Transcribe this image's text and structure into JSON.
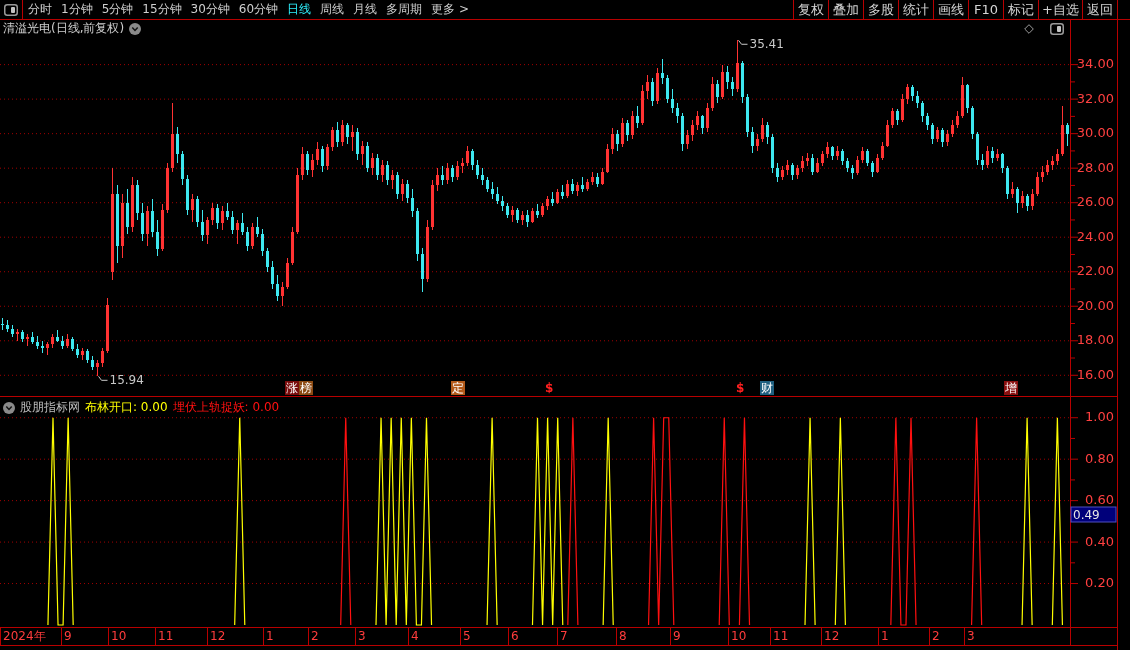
{
  "toolbar": {
    "period_tabs": [
      {
        "label": "分时",
        "selected": false
      },
      {
        "label": "1分钟",
        "selected": false
      },
      {
        "label": "5分钟",
        "selected": false
      },
      {
        "label": "15分钟",
        "selected": false
      },
      {
        "label": "30分钟",
        "selected": false
      },
      {
        "label": "60分钟",
        "selected": false
      },
      {
        "label": "日线",
        "selected": true
      },
      {
        "label": "周线",
        "selected": false
      },
      {
        "label": "月线",
        "selected": false
      },
      {
        "label": "多周期",
        "selected": false
      },
      {
        "label": "更多 >",
        "selected": false
      }
    ],
    "buttons": [
      "复权",
      "叠加",
      "多股",
      "统计",
      "画线",
      "F10",
      "标记",
      "+自选",
      "返回"
    ]
  },
  "price_pane": {
    "title": "清溢光电(日线,前复权)",
    "chart_data": [
      {
        "type": "candlestick",
        "ylim": [
          14.8,
          35.6
        ],
        "yticks": [
          {
            "value": 16,
            "label": "16.00"
          },
          {
            "value": 18,
            "label": "18.00"
          },
          {
            "value": 20,
            "label": "20.00"
          },
          {
            "value": 22,
            "label": "22.00"
          },
          {
            "value": 24,
            "label": "24.00"
          },
          {
            "value": 26,
            "label": "26.00"
          },
          {
            "value": 28,
            "label": "28.00"
          },
          {
            "value": 30,
            "label": "30.00"
          },
          {
            "value": 32,
            "label": "32.00"
          },
          {
            "value": 34,
            "label": "34.00"
          }
        ],
        "grid": true,
        "annotations": [
          "35.41",
          "15.94"
        ],
        "ohlc": [
          [
            19.0,
            19.3,
            18.6,
            18.9
          ],
          [
            18.9,
            19.2,
            18.5,
            18.7
          ],
          [
            18.7,
            18.9,
            18.2,
            18.4
          ],
          [
            18.4,
            18.7,
            18.0,
            18.5
          ],
          [
            18.5,
            18.6,
            17.9,
            18.1
          ],
          [
            18.1,
            18.4,
            17.7,
            18.2
          ],
          [
            18.2,
            18.5,
            17.8,
            17.9
          ],
          [
            17.9,
            18.3,
            17.5,
            17.7
          ],
          [
            17.7,
            18.0,
            17.3,
            17.6
          ],
          [
            17.6,
            17.9,
            17.2,
            17.8
          ],
          [
            17.8,
            18.4,
            17.6,
            18.2
          ],
          [
            18.2,
            18.6,
            17.9,
            18.0
          ],
          [
            18.0,
            18.3,
            17.5,
            17.7
          ],
          [
            17.7,
            18.4,
            17.6,
            18.1
          ],
          [
            18.1,
            18.2,
            17.4,
            17.5
          ],
          [
            17.5,
            17.8,
            17.0,
            17.2
          ],
          [
            17.2,
            17.6,
            16.9,
            17.4
          ],
          [
            17.4,
            17.5,
            16.7,
            16.9
          ],
          [
            16.9,
            17.1,
            16.3,
            16.5
          ],
          [
            16.5,
            16.9,
            15.94,
            16.7
          ],
          [
            16.7,
            17.6,
            16.5,
            17.4
          ],
          [
            17.4,
            20.5,
            17.3,
            20.1
          ],
          [
            22.0,
            28.0,
            21.5,
            26.5
          ],
          [
            26.5,
            27.0,
            22.5,
            23.5
          ],
          [
            23.5,
            26.5,
            22.8,
            26.0
          ],
          [
            26.0,
            26.8,
            24.2,
            24.6
          ],
          [
            24.6,
            27.5,
            24.3,
            27.0
          ],
          [
            27.0,
            27.3,
            25.0,
            25.4
          ],
          [
            25.4,
            26.0,
            23.8,
            24.2
          ],
          [
            24.2,
            25.8,
            23.5,
            25.5
          ],
          [
            25.5,
            26.2,
            24.0,
            24.3
          ],
          [
            24.3,
            25.0,
            22.9,
            23.3
          ],
          [
            23.3,
            25.9,
            23.2,
            25.6
          ],
          [
            25.6,
            28.3,
            25.4,
            28.0
          ],
          [
            28.0,
            31.8,
            27.8,
            30.0
          ],
          [
            30.0,
            30.4,
            28.3,
            28.8
          ],
          [
            28.8,
            29.0,
            27.0,
            27.4
          ],
          [
            27.4,
            27.6,
            25.3,
            25.6
          ],
          [
            25.6,
            26.5,
            24.9,
            26.2
          ],
          [
            26.2,
            26.4,
            24.6,
            24.9
          ],
          [
            24.9,
            25.6,
            23.8,
            24.1
          ],
          [
            24.1,
            25.2,
            23.6,
            25.0
          ],
          [
            25.0,
            26.0,
            24.7,
            25.7
          ],
          [
            25.7,
            25.9,
            24.5,
            24.8
          ],
          [
            24.8,
            25.8,
            24.4,
            25.5
          ],
          [
            25.5,
            26.0,
            25.0,
            25.2
          ],
          [
            25.2,
            25.5,
            24.2,
            24.4
          ],
          [
            24.4,
            25.0,
            23.6,
            24.8
          ],
          [
            24.8,
            25.4,
            24.1,
            24.3
          ],
          [
            24.3,
            24.6,
            23.2,
            23.5
          ],
          [
            23.5,
            24.8,
            23.3,
            24.6
          ],
          [
            24.6,
            25.2,
            24.0,
            24.2
          ],
          [
            24.2,
            24.5,
            22.9,
            23.2
          ],
          [
            23.2,
            23.4,
            22.0,
            22.3
          ],
          [
            22.3,
            22.6,
            21.0,
            21.3
          ],
          [
            21.3,
            21.8,
            20.3,
            20.6
          ],
          [
            20.6,
            21.4,
            20.0,
            21.1
          ],
          [
            21.1,
            22.8,
            21.0,
            22.5
          ],
          [
            22.5,
            24.6,
            22.4,
            24.3
          ],
          [
            24.3,
            28.0,
            24.2,
            27.6
          ],
          [
            27.6,
            29.2,
            27.3,
            28.8
          ],
          [
            28.8,
            29.0,
            27.6,
            27.9
          ],
          [
            27.9,
            28.8,
            27.5,
            28.5
          ],
          [
            28.5,
            29.5,
            28.2,
            29.1
          ],
          [
            29.1,
            29.3,
            27.8,
            28.1
          ],
          [
            28.1,
            29.4,
            27.9,
            29.2
          ],
          [
            29.2,
            30.4,
            29.0,
            30.2
          ],
          [
            30.2,
            30.7,
            29.2,
            29.5
          ],
          [
            29.5,
            30.8,
            29.3,
            30.5
          ],
          [
            30.5,
            30.6,
            29.4,
            29.8
          ],
          [
            29.8,
            30.5,
            29.0,
            30.1
          ],
          [
            30.1,
            30.3,
            28.5,
            28.8
          ],
          [
            28.8,
            29.6,
            28.2,
            29.3
          ],
          [
            29.3,
            29.5,
            27.8,
            28.0
          ],
          [
            28.0,
            28.9,
            27.6,
            28.6
          ],
          [
            28.6,
            28.8,
            27.3,
            27.6
          ],
          [
            27.6,
            28.5,
            27.2,
            28.2
          ],
          [
            28.2,
            28.4,
            27.0,
            27.3
          ],
          [
            27.3,
            27.9,
            26.8,
            27.6
          ],
          [
            27.6,
            27.8,
            26.2,
            26.5
          ],
          [
            26.5,
            27.4,
            26.1,
            27.1
          ],
          [
            27.1,
            27.3,
            26.0,
            26.3
          ],
          [
            26.3,
            26.8,
            25.2,
            25.5
          ],
          [
            25.5,
            25.7,
            22.6,
            23.0
          ],
          [
            23.0,
            23.4,
            20.8,
            21.6
          ],
          [
            21.6,
            25.0,
            21.4,
            24.6
          ],
          [
            24.6,
            27.3,
            24.4,
            27.0
          ],
          [
            27.0,
            28.0,
            26.7,
            27.6
          ],
          [
            27.6,
            28.1,
            27.0,
            27.3
          ],
          [
            27.3,
            28.3,
            27.1,
            28.0
          ],
          [
            28.0,
            28.2,
            27.2,
            27.5
          ],
          [
            27.5,
            28.4,
            27.3,
            28.1
          ],
          [
            28.1,
            28.6,
            27.7,
            28.3
          ],
          [
            28.3,
            29.3,
            28.1,
            29.0
          ],
          [
            29.0,
            29.1,
            27.9,
            28.2
          ],
          [
            28.2,
            28.5,
            27.4,
            27.6
          ],
          [
            27.6,
            28.0,
            27.0,
            27.3
          ],
          [
            27.3,
            27.5,
            26.6,
            26.8
          ],
          [
            26.8,
            27.2,
            26.2,
            26.5
          ],
          [
            26.5,
            26.9,
            25.9,
            26.1
          ],
          [
            26.1,
            26.4,
            25.5,
            25.8
          ],
          [
            25.8,
            26.0,
            25.1,
            25.3
          ],
          [
            25.3,
            25.8,
            24.9,
            25.6
          ],
          [
            25.6,
            25.7,
            24.8,
            25.0
          ],
          [
            25.0,
            25.5,
            24.7,
            25.3
          ],
          [
            25.3,
            25.6,
            24.6,
            24.9
          ],
          [
            24.9,
            25.7,
            24.8,
            25.5
          ],
          [
            25.5,
            25.9,
            25.1,
            25.3
          ],
          [
            25.3,
            26.0,
            25.2,
            25.8
          ],
          [
            25.8,
            26.4,
            25.6,
            26.2
          ],
          [
            26.2,
            26.6,
            25.8,
            26.0
          ],
          [
            26.0,
            26.8,
            25.9,
            26.6
          ],
          [
            26.6,
            27.0,
            26.2,
            26.4
          ],
          [
            26.4,
            27.3,
            26.3,
            27.1
          ],
          [
            27.1,
            27.4,
            26.5,
            26.7
          ],
          [
            26.7,
            27.2,
            26.4,
            27.0
          ],
          [
            27.0,
            27.5,
            26.6,
            26.8
          ],
          [
            26.8,
            27.4,
            26.7,
            27.2
          ],
          [
            27.2,
            27.8,
            27.0,
            27.5
          ],
          [
            27.5,
            27.7,
            26.9,
            27.1
          ],
          [
            27.1,
            28.0,
            27.0,
            27.8
          ],
          [
            27.8,
            29.4,
            27.7,
            29.1
          ],
          [
            29.1,
            30.3,
            28.8,
            30.0
          ],
          [
            30.0,
            30.2,
            29.0,
            29.4
          ],
          [
            29.4,
            30.9,
            29.2,
            30.6
          ],
          [
            30.6,
            30.8,
            29.6,
            29.9
          ],
          [
            29.9,
            31.3,
            29.7,
            31.0
          ],
          [
            31.0,
            31.6,
            30.3,
            30.6
          ],
          [
            30.6,
            32.8,
            30.5,
            32.5
          ],
          [
            32.5,
            33.4,
            32.0,
            33.0
          ],
          [
            33.0,
            33.2,
            31.6,
            31.9
          ],
          [
            31.9,
            33.8,
            31.7,
            33.5
          ],
          [
            33.5,
            34.3,
            32.9,
            33.2
          ],
          [
            33.2,
            33.4,
            31.8,
            32.0
          ],
          [
            32.0,
            32.6,
            31.2,
            31.5
          ],
          [
            31.5,
            31.8,
            30.6,
            31.0
          ],
          [
            31.0,
            31.2,
            29.0,
            29.4
          ],
          [
            29.4,
            30.2,
            29.1,
            29.9
          ],
          [
            29.9,
            30.8,
            29.6,
            30.5
          ],
          [
            30.5,
            31.3,
            30.2,
            31.0
          ],
          [
            31.0,
            31.1,
            30.0,
            30.3
          ],
          [
            30.3,
            31.8,
            30.1,
            31.5
          ],
          [
            31.5,
            33.3,
            31.3,
            32.9
          ],
          [
            32.9,
            33.1,
            31.8,
            32.1
          ],
          [
            32.1,
            34.0,
            32.0,
            33.6
          ],
          [
            33.6,
            33.9,
            32.6,
            33.0
          ],
          [
            33.0,
            33.3,
            32.2,
            32.6
          ],
          [
            32.6,
            35.41,
            32.4,
            34.1
          ],
          [
            34.1,
            34.2,
            31.8,
            32.1
          ],
          [
            32.1,
            32.3,
            29.8,
            30.1
          ],
          [
            30.1,
            30.4,
            28.9,
            29.3
          ],
          [
            29.3,
            30.0,
            29.0,
            29.7
          ],
          [
            29.7,
            30.9,
            29.5,
            30.5
          ],
          [
            30.5,
            30.7,
            29.4,
            29.8
          ],
          [
            29.8,
            30.0,
            27.7,
            28.0
          ],
          [
            28.0,
            28.3,
            27.2,
            27.5
          ],
          [
            27.5,
            28.1,
            27.3,
            27.9
          ],
          [
            27.9,
            28.5,
            27.6,
            28.2
          ],
          [
            28.2,
            28.3,
            27.3,
            27.6
          ],
          [
            27.6,
            28.2,
            27.4,
            28.0
          ],
          [
            28.0,
            28.7,
            27.8,
            28.4
          ],
          [
            28.4,
            28.9,
            28.1,
            28.6
          ],
          [
            28.6,
            28.8,
            27.6,
            27.8
          ],
          [
            27.8,
            28.6,
            27.7,
            28.3
          ],
          [
            28.3,
            29.0,
            28.1,
            28.8
          ],
          [
            28.8,
            29.5,
            28.6,
            29.2
          ],
          [
            29.2,
            29.3,
            28.5,
            28.7
          ],
          [
            28.7,
            29.3,
            28.5,
            29.0
          ],
          [
            29.0,
            29.1,
            28.2,
            28.4
          ],
          [
            28.4,
            28.6,
            27.8,
            28.0
          ],
          [
            28.0,
            28.2,
            27.4,
            27.7
          ],
          [
            27.7,
            28.7,
            27.6,
            28.5
          ],
          [
            28.5,
            29.2,
            28.3,
            29.0
          ],
          [
            29.0,
            29.1,
            28.1,
            28.3
          ],
          [
            28.3,
            28.4,
            27.5,
            27.8
          ],
          [
            27.8,
            28.8,
            27.7,
            28.6
          ],
          [
            28.6,
            29.5,
            28.5,
            29.3
          ],
          [
            29.3,
            30.8,
            29.2,
            30.5
          ],
          [
            30.5,
            31.5,
            30.3,
            31.3
          ],
          [
            31.3,
            31.4,
            30.5,
            30.8
          ],
          [
            30.8,
            32.3,
            30.7,
            32.0
          ],
          [
            32.0,
            32.9,
            31.7,
            32.7
          ],
          [
            32.7,
            32.8,
            31.9,
            32.2
          ],
          [
            32.2,
            32.5,
            31.5,
            31.8
          ],
          [
            31.8,
            31.9,
            30.7,
            31.0
          ],
          [
            31.0,
            31.2,
            30.2,
            30.5
          ],
          [
            30.5,
            30.6,
            29.4,
            29.7
          ],
          [
            29.7,
            30.4,
            29.5,
            30.2
          ],
          [
            30.2,
            30.3,
            29.2,
            29.5
          ],
          [
            29.5,
            30.2,
            29.3,
            30.0
          ],
          [
            30.0,
            30.8,
            29.8,
            30.5
          ],
          [
            30.5,
            31.3,
            30.3,
            31.0
          ],
          [
            31.0,
            33.3,
            30.9,
            32.8
          ],
          [
            32.8,
            32.9,
            31.2,
            31.5
          ],
          [
            31.5,
            31.6,
            29.7,
            30.0
          ],
          [
            30.0,
            30.1,
            28.2,
            28.5
          ],
          [
            28.5,
            28.8,
            27.9,
            28.2
          ],
          [
            28.2,
            29.3,
            28.0,
            29.0
          ],
          [
            29.0,
            29.2,
            28.3,
            28.6
          ],
          [
            28.6,
            29.1,
            28.4,
            28.8
          ],
          [
            28.8,
            28.9,
            27.7,
            28.0
          ],
          [
            28.0,
            28.1,
            26.2,
            26.5
          ],
          [
            26.5,
            27.2,
            26.3,
            26.8
          ],
          [
            26.8,
            26.9,
            25.4,
            26.0
          ],
          [
            26.0,
            26.7,
            25.7,
            26.4
          ],
          [
            26.4,
            26.5,
            25.5,
            25.8
          ],
          [
            25.8,
            26.8,
            25.6,
            26.5
          ],
          [
            26.5,
            27.8,
            26.4,
            27.5
          ],
          [
            27.5,
            28.1,
            27.2,
            27.8
          ],
          [
            27.8,
            28.5,
            27.6,
            28.2
          ],
          [
            28.2,
            28.7,
            27.9,
            28.4
          ],
          [
            28.4,
            29.1,
            28.2,
            28.8
          ],
          [
            28.8,
            31.6,
            28.7,
            30.5
          ],
          [
            30.5,
            30.6,
            29.3,
            30.0
          ]
        ]
      }
    ],
    "event_markers": [
      {
        "text": "涨",
        "kind": "badge",
        "color": "#7a0c0c"
      },
      {
        "text": "榜",
        "kind": "badge",
        "color": "#8c4a12"
      },
      {
        "text": "定",
        "kind": "badge",
        "color": "#b35a1a"
      },
      {
        "text": "$",
        "kind": "glyph",
        "color": "#ff2020"
      },
      {
        "text": "$",
        "kind": "glyph",
        "color": "#ff2020"
      },
      {
        "text": "财",
        "kind": "badge",
        "color": "#1f5f7f"
      },
      {
        "text": "增",
        "kind": "badge",
        "color": "#8a1010"
      }
    ]
  },
  "indicator_pane": {
    "source": "股朋指标网",
    "legend": [
      {
        "label": "布林开口: 0.00",
        "color": "#ffff00"
      },
      {
        "label": "埋伏上轨捉妖: 0.00",
        "color": "#ff1010"
      }
    ],
    "cursor_value": "0.49",
    "chart_data": [
      {
        "type": "line",
        "ylim": [
          0,
          1.1
        ],
        "yticks": [
          {
            "value": 0.2,
            "label": "0.20"
          },
          {
            "value": 0.4,
            "label": "0.40"
          },
          {
            "value": 0.6,
            "label": "0.60"
          },
          {
            "value": 0.8,
            "label": "0.80"
          },
          {
            "value": 1.0,
            "label": "1.00"
          }
        ],
        "grid": true,
        "series": [
          {
            "color": "#ffff00",
            "values": [
              null,
              null,
              null,
              null,
              null,
              null,
              null,
              null,
              null,
              0,
              1,
              0,
              0,
              1,
              0,
              null,
              null,
              null,
              null,
              null,
              null,
              null,
              null,
              null,
              null,
              null,
              null,
              null,
              null,
              null,
              null,
              null,
              null,
              null,
              null,
              null,
              null,
              null,
              null,
              null,
              null,
              null,
              null,
              null,
              null,
              null,
              0,
              1,
              0,
              null,
              null,
              null,
              null,
              null,
              null,
              null,
              null,
              null,
              null,
              null,
              null,
              null,
              null,
              null,
              null,
              null,
              null,
              null,
              null,
              null,
              null,
              null,
              null,
              null,
              0,
              1,
              0,
              1,
              0,
              1,
              0,
              1,
              0,
              0,
              1,
              0,
              null,
              null,
              null,
              null,
              null,
              null,
              null,
              null,
              null,
              null,
              0,
              1,
              0,
              null,
              null,
              null,
              null,
              null,
              null,
              0,
              1,
              0,
              1,
              0,
              1,
              0,
              null,
              null,
              null,
              null,
              null,
              null,
              null,
              0,
              1,
              0,
              null,
              null,
              null,
              null,
              null,
              null,
              null,
              null,
              null,
              null,
              null,
              null,
              null,
              null,
              null,
              null,
              null,
              null,
              null,
              null,
              null,
              null,
              null,
              null,
              null,
              null,
              null,
              null,
              null,
              null,
              null,
              null,
              null,
              null,
              null,
              null,
              null,
              0,
              1,
              0,
              null,
              null,
              null,
              0,
              1,
              0,
              null,
              null,
              null,
              null,
              null,
              null,
              null,
              null,
              null,
              null,
              null,
              null,
              null,
              null,
              null,
              null,
              null,
              null,
              null,
              null,
              null,
              null,
              null,
              null,
              null,
              null,
              null,
              null,
              null,
              null,
              null,
              null,
              null,
              null,
              0,
              1,
              0,
              null,
              null,
              null,
              0,
              1,
              0,
              null
            ]
          },
          {
            "color": "#ff1010",
            "values": [
              null,
              null,
              null,
              null,
              null,
              null,
              null,
              null,
              null,
              null,
              null,
              null,
              null,
              null,
              null,
              null,
              null,
              null,
              null,
              null,
              null,
              null,
              null,
              null,
              null,
              null,
              null,
              null,
              null,
              null,
              null,
              null,
              null,
              null,
              null,
              null,
              null,
              null,
              null,
              null,
              null,
              null,
              null,
              null,
              null,
              null,
              null,
              null,
              null,
              null,
              null,
              null,
              null,
              null,
              null,
              null,
              null,
              null,
              null,
              null,
              null,
              null,
              null,
              null,
              null,
              null,
              null,
              0,
              1,
              0,
              null,
              null,
              null,
              null,
              null,
              null,
              null,
              null,
              null,
              null,
              null,
              null,
              null,
              null,
              null,
              null,
              null,
              null,
              null,
              null,
              null,
              null,
              null,
              null,
              null,
              null,
              null,
              null,
              null,
              null,
              null,
              null,
              null,
              null,
              null,
              null,
              null,
              null,
              null,
              null,
              null,
              null,
              0,
              1,
              0,
              null,
              null,
              null,
              null,
              null,
              null,
              null,
              null,
              null,
              null,
              null,
              null,
              null,
              0,
              1,
              0,
              1,
              1,
              0,
              null,
              null,
              null,
              null,
              null,
              null,
              null,
              null,
              0,
              1,
              0,
              null,
              0,
              1,
              0,
              null,
              null,
              null,
              null,
              null,
              null,
              null,
              null,
              null,
              null,
              null,
              null,
              null,
              null,
              null,
              null,
              null,
              null,
              null,
              null,
              null,
              null,
              null,
              null,
              null,
              null,
              null,
              0,
              1,
              0,
              0,
              1,
              0,
              null,
              null,
              null,
              null,
              null,
              null,
              null,
              null,
              null,
              null,
              0,
              1,
              0,
              null,
              null,
              null,
              null,
              null,
              null,
              null,
              null,
              null,
              null,
              null,
              null,
              null,
              null,
              null,
              null,
              null
            ]
          }
        ]
      }
    ]
  },
  "date_axis": [
    "2024年",
    "9",
    "10",
    "11",
    "12",
    "1",
    "2",
    "3",
    "4",
    "5",
    "6",
    "7",
    "8",
    "9",
    "10",
    "11",
    "12",
    "1",
    "2",
    "3"
  ]
}
